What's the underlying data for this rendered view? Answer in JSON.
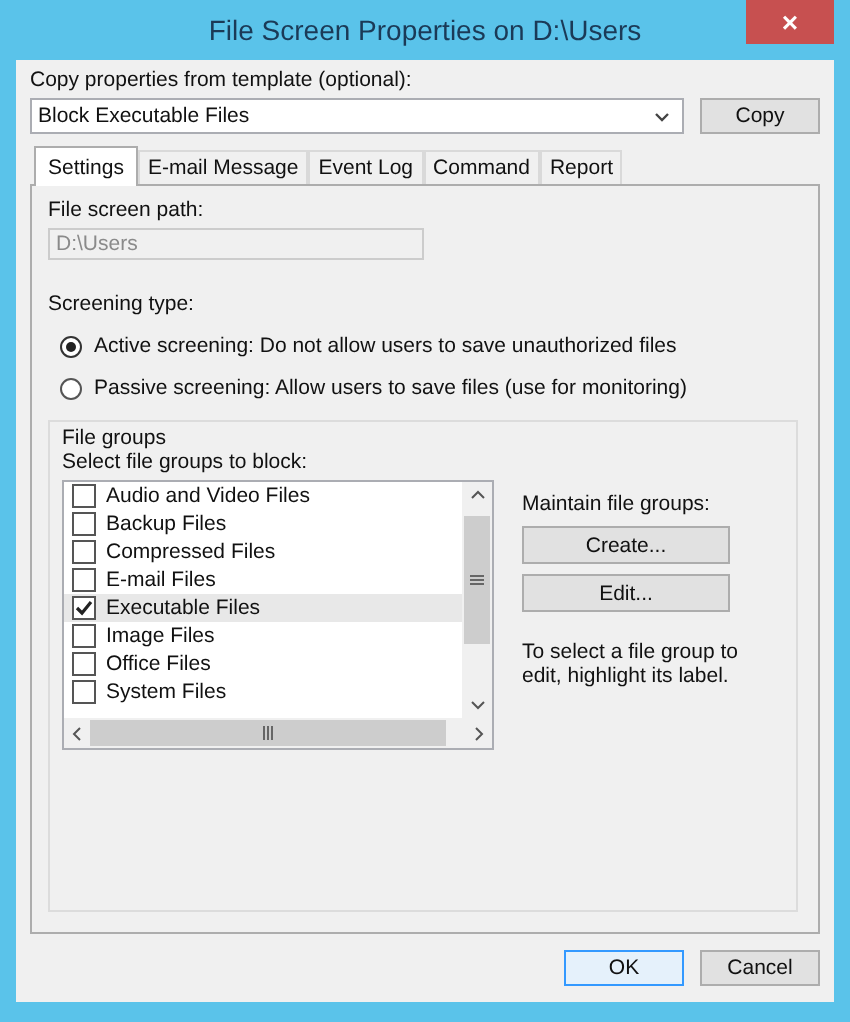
{
  "window": {
    "title": "File Screen Properties on D:\\Users",
    "close": "×"
  },
  "template": {
    "label": "Copy properties from template (optional):",
    "value": "Block Executable Files",
    "copy_button": "Copy"
  },
  "tabs": [
    {
      "label": "Settings",
      "selected": true
    },
    {
      "label": "E-mail Message",
      "selected": false
    },
    {
      "label": "Event Log",
      "selected": false
    },
    {
      "label": "Command",
      "selected": false
    },
    {
      "label": "Report",
      "selected": false
    }
  ],
  "path": {
    "label": "File screen path:",
    "value": "D:\\Users",
    "disabled": true
  },
  "screening": {
    "label": "Screening type:",
    "options": [
      {
        "label": "Active screening: Do not allow users to save unauthorized files",
        "selected": true
      },
      {
        "label": "Passive screening: Allow users to save files (use for monitoring)",
        "selected": false
      }
    ]
  },
  "file_groups": {
    "legend": "File groups",
    "list_label": "Select file groups to block:",
    "items": [
      {
        "label": "Audio and Video Files",
        "checked": false,
        "selected": false
      },
      {
        "label": "Backup Files",
        "checked": false,
        "selected": false
      },
      {
        "label": "Compressed Files",
        "checked": false,
        "selected": false
      },
      {
        "label": "E-mail Files",
        "checked": false,
        "selected": false
      },
      {
        "label": "Executable Files",
        "checked": true,
        "selected": true
      },
      {
        "label": "Image Files",
        "checked": false,
        "selected": false
      },
      {
        "label": "Office Files",
        "checked": false,
        "selected": false
      },
      {
        "label": "System Files",
        "checked": false,
        "selected": false
      }
    ],
    "maintain_label": "Maintain file groups:",
    "create_button": "Create...",
    "edit_button": "Edit...",
    "hint": "To select a file group to edit, highlight its label."
  },
  "buttons": [
    "OK",
    "Cancel"
  ]
}
